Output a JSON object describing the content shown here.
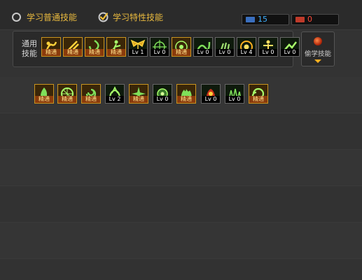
{
  "tabs": {
    "normal_label": "学习普通技能",
    "special_label": "学习特性技能"
  },
  "counters": {
    "points_a": "15",
    "points_b": "0",
    "color_a": "#3fb0ff",
    "color_b": "#ff4a3a"
  },
  "common": {
    "label": "通用技能",
    "skills": [
      {
        "icon": "kneel-icon",
        "tag": "精通",
        "mastered": true
      },
      {
        "icon": "slash-icon",
        "tag": "精通",
        "mastered": true
      },
      {
        "icon": "leaf-whirl-icon",
        "tag": "精通",
        "mastered": true
      },
      {
        "icon": "run-icon",
        "tag": "精通",
        "mastered": true
      },
      {
        "icon": "wings-icon",
        "tag": "Lv 1",
        "mastered": false
      },
      {
        "icon": "crosshair-icon",
        "tag": "Lv 0",
        "mastered": false
      },
      {
        "icon": "target-icon",
        "tag": "精通",
        "mastered": true
      },
      {
        "icon": "vine-icon",
        "tag": "Lv 0",
        "mastered": false
      },
      {
        "icon": "claw-icon",
        "tag": "Lv 0",
        "mastered": false
      },
      {
        "icon": "eye-ring-icon",
        "tag": "Lv 4",
        "mastered": false
      },
      {
        "icon": "stance-icon",
        "tag": "Lv 0",
        "mastered": false
      },
      {
        "icon": "dash-icon",
        "tag": "Lv 0",
        "mastered": false
      }
    ]
  },
  "special": {
    "skills": [
      {
        "icon": "flame-icon",
        "tag": "精通",
        "mastered": true
      },
      {
        "icon": "rune-icon",
        "tag": "精通",
        "mastered": true
      },
      {
        "icon": "spiral-icon",
        "tag": "精通",
        "mastered": true
      },
      {
        "icon": "grip-icon",
        "tag": "Lv 2",
        "mastered": false
      },
      {
        "icon": "burst-icon",
        "tag": "精通",
        "mastered": true
      },
      {
        "icon": "orb-icon",
        "tag": "Lv 0",
        "mastered": false
      },
      {
        "icon": "fire-icon",
        "tag": "精通",
        "mastered": true
      },
      {
        "icon": "blood-icon",
        "tag": "Lv 0",
        "mastered": false
      },
      {
        "icon": "forest-icon",
        "tag": "Lv 0",
        "mastered": false
      },
      {
        "icon": "swirl-icon",
        "tag": "精通",
        "mastered": true
      }
    ]
  },
  "steal": {
    "label": "偷学技能"
  }
}
